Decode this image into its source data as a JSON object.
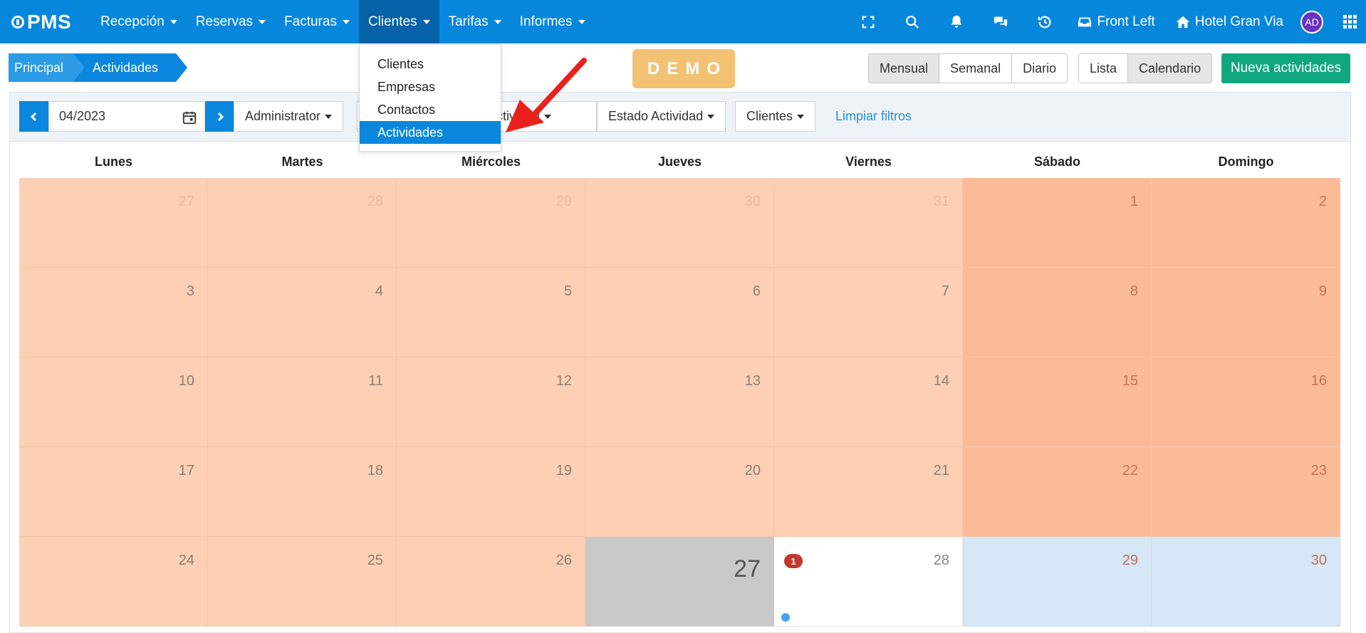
{
  "app": {
    "logo": "PMS"
  },
  "navbar": {
    "menu": [
      {
        "label": "Recepción"
      },
      {
        "label": "Reservas"
      },
      {
        "label": "Facturas"
      },
      {
        "label": "Clientes",
        "active": true
      },
      {
        "label": "Tarifas"
      },
      {
        "label": "Informes"
      }
    ],
    "icons": [
      "fullscreen-icon",
      "search-icon",
      "bell-icon",
      "chat-icon",
      "history-icon"
    ],
    "front_label": "Front Left",
    "hotel_label": "Hotel Gran Via",
    "avatar_initials": "AD"
  },
  "breadcrumb": {
    "items": [
      "Principal",
      "Actividades"
    ]
  },
  "demo_label": "DEMO",
  "view_toggle": {
    "periods": [
      "Mensual",
      "Semanal",
      "Diario"
    ],
    "modes": [
      "Lista",
      "Calendario"
    ],
    "selected_period": "Mensual",
    "selected_mode": "Calendario"
  },
  "new_button_label": "Nueva actividades",
  "filters": {
    "date_value": "04/2023",
    "administrator": "Administrator",
    "tipo_actividad_partial": "e ctividad",
    "estado_actividad": "Estado Actividad",
    "clientes": "Clientes",
    "clear_label": "Limpiar filtros"
  },
  "dropdown": {
    "items": [
      {
        "label": "Clientes"
      },
      {
        "label": "Empresas"
      },
      {
        "label": "Contactos"
      },
      {
        "label": "Actividades",
        "active": true
      }
    ]
  },
  "calendar": {
    "weekdays": [
      "Lunes",
      "Martes",
      "Miércoles",
      "Jueves",
      "Viernes",
      "Sábado",
      "Domingo"
    ],
    "weeks": [
      [
        "27",
        "28",
        "29",
        "30",
        "31",
        "1",
        "2"
      ],
      [
        "3",
        "4",
        "5",
        "6",
        "7",
        "8",
        "9"
      ],
      [
        "10",
        "11",
        "12",
        "13",
        "14",
        "15",
        "16"
      ],
      [
        "17",
        "18",
        "19",
        "20",
        "21",
        "22",
        "23"
      ],
      [
        "24",
        "25",
        "26",
        "27",
        "28",
        "29",
        "30"
      ]
    ],
    "today": "27",
    "event_day": "28",
    "event_count": "1"
  },
  "colors": {
    "navbar": "#0787dc",
    "past_day": "#fdd0b5",
    "weekend": "#fcbb97",
    "today": "#c9c9c9",
    "future_weekend": "#d6e7f5",
    "primary_button": "#10a77e",
    "demo_badge": "#f2c173",
    "arrow": "#e8211c"
  }
}
